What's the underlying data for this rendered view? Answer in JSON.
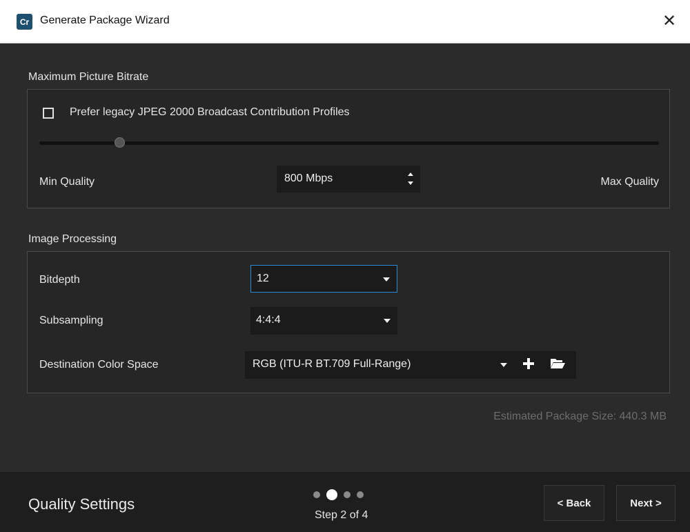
{
  "window": {
    "app_icon_text": "Cr",
    "title": "Generate Package Wizard",
    "close_glyph": "✕"
  },
  "bitrate": {
    "section_label": "Maximum Picture Bitrate",
    "legacy_checkbox_label": "Prefer legacy JPEG 2000 Broadcast Contribution Profiles",
    "legacy_checked": false,
    "slider_level_fraction": 0.13,
    "min_label": "Min Quality",
    "max_label": "Max Quality",
    "value": "800 Mbps"
  },
  "image_processing": {
    "section_label": "Image Processing",
    "bitdepth_label": "Bitdepth",
    "bitdepth_value": "12",
    "subsampling_label": "Subsampling",
    "subsampling_value": "4:4:4",
    "color_space_label": "Destination Color Space",
    "color_space_value": "RGB (ITU-R BT.709 Full-Range)"
  },
  "estimated_size": "Estimated Package Size: 440.3 MB",
  "footer": {
    "title": "Quality Settings",
    "step_text": "Step 2 of 4",
    "current_step": 2,
    "total_steps": 4,
    "back_label": "< Back",
    "next_label": "Next >"
  },
  "icons": [
    "app-icon",
    "close-icon",
    "checkbox-icon",
    "spin-arrows-icon",
    "chevron-down-icon",
    "plus-icon",
    "folder-open-icon"
  ],
  "colors": {
    "background": "#2b2b2b",
    "panel": "#262626",
    "footer": "#1e1e1e",
    "focus_border": "#2b8bd9",
    "muted_text": "#6d6d6d"
  }
}
